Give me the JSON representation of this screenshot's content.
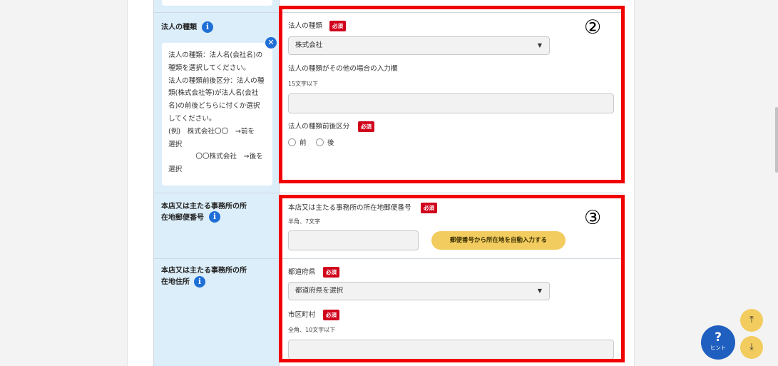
{
  "section_corporation_type": {
    "label": "法人の種類",
    "tooltip": "法人の種類：法人名(会社名)の\n種類を選択してください。\n法人の種類前後区分：法人の種\n類(株式会社等)が法人名(会社\n名)の前後どちらに付くか選択\nしてください。\n(例)　株式会社〇〇　→前を\n選択\n　　　　〇〇株式会社　→後を\n選択",
    "type_field_label": "法人の種類",
    "type_selected": "株式会社",
    "other_field_label": "法人の種類がその他の場合の入力欄",
    "other_field_hint": "15文字以下",
    "position_field_label": "法人の種類前後区分",
    "position_options": [
      "前",
      "後"
    ]
  },
  "section_postal": {
    "label_line1": "本店又は主たる事務所の所",
    "label_line2": "在地郵便番号",
    "field_label": "本店又は主たる事務所の所在地郵便番号",
    "hint": "半角、7文字",
    "auto_fill_button": "郵便番号から所在地を自動入力する"
  },
  "section_address": {
    "label_line1": "本店又は主たる事務所の所",
    "label_line2": "在地住所",
    "prefecture_label": "都道府県",
    "prefecture_placeholder": "都道府県を選択",
    "city_label": "市区町村",
    "city_hint": "全角、10文字以下"
  },
  "required_badge": "必須",
  "annotations": {
    "box2": "②",
    "box3": "③"
  },
  "floating": {
    "hint_q": "?",
    "hint_label": "ヒント"
  },
  "icons": {
    "info": "info-icon",
    "close": "close-icon",
    "dropdown": "triangle-down-icon",
    "scroll_top": "arrow-to-top-icon",
    "scroll_bottom": "arrow-to-bottom-icon"
  },
  "colors": {
    "required": "#d0021b",
    "label_background": "#dceefa",
    "accent_blue": "#1f6fd6",
    "button_yellow": "#f2cc5f",
    "annotation_red": "#f00000"
  }
}
